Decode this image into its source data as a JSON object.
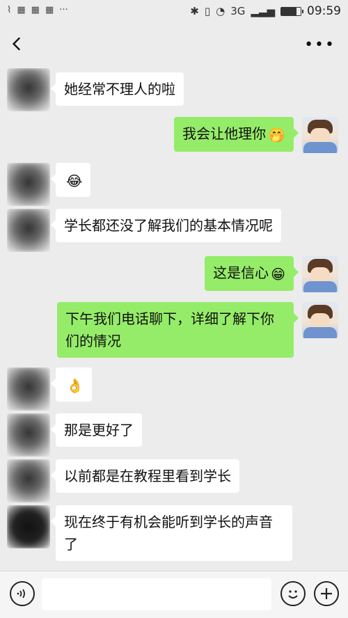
{
  "status_bar": {
    "time": "09:59",
    "left_icons": [
      "notification-icon",
      "app-icon",
      "app-icon",
      "app-icon",
      "more-dots-icon"
    ],
    "right_icons": [
      "bluetooth-icon",
      "vibrate-icon",
      "wifi-icon",
      "signal-icon",
      "battery-icon"
    ],
    "network_label": "3G",
    "battery_level": 0.8
  },
  "nav": {
    "back_icon": "back-chevron-icon",
    "more_icon": "more-options-icon",
    "more_label": "•••"
  },
  "messages": [
    {
      "side": "left",
      "text": "她经常不理人的啦",
      "avatar": "blurred-avatar"
    },
    {
      "side": "right",
      "text": "我会让他理你",
      "emoji": "🤭",
      "avatar": "anime-avatar"
    },
    {
      "side": "left",
      "text": "",
      "emoji": "😂",
      "avatar": "blurred-avatar"
    },
    {
      "side": "left",
      "text": "学长都还没了解我们的基本情况呢",
      "avatar": "blurred-avatar"
    },
    {
      "side": "right",
      "text": "这是信心",
      "emoji": "😁",
      "avatar": "anime-avatar"
    },
    {
      "side": "right",
      "text": "下午我们电话聊下，详细了解下你们的情况",
      "avatar": "anime-avatar"
    },
    {
      "side": "left",
      "text": "",
      "emoji": "👌",
      "avatar": "blurred-avatar"
    },
    {
      "side": "left",
      "text": "那是更好了",
      "avatar": "blurred-avatar"
    },
    {
      "side": "left",
      "text": "以前都是在教程里看到学长",
      "avatar": "blurred-avatar"
    },
    {
      "side": "left",
      "text": "现在终于有机会能听到学长的声音了",
      "avatar": "dark-avatar"
    }
  ],
  "input_bar": {
    "voice_icon": "voice-icon",
    "emoji_icon": "smile-icon",
    "plus_icon": "plus-icon",
    "input_value": "",
    "input_placeholder": ""
  },
  "colors": {
    "background": "#ececec",
    "sent_bubble": "#95ec69",
    "received_bubble": "#ffffff"
  }
}
